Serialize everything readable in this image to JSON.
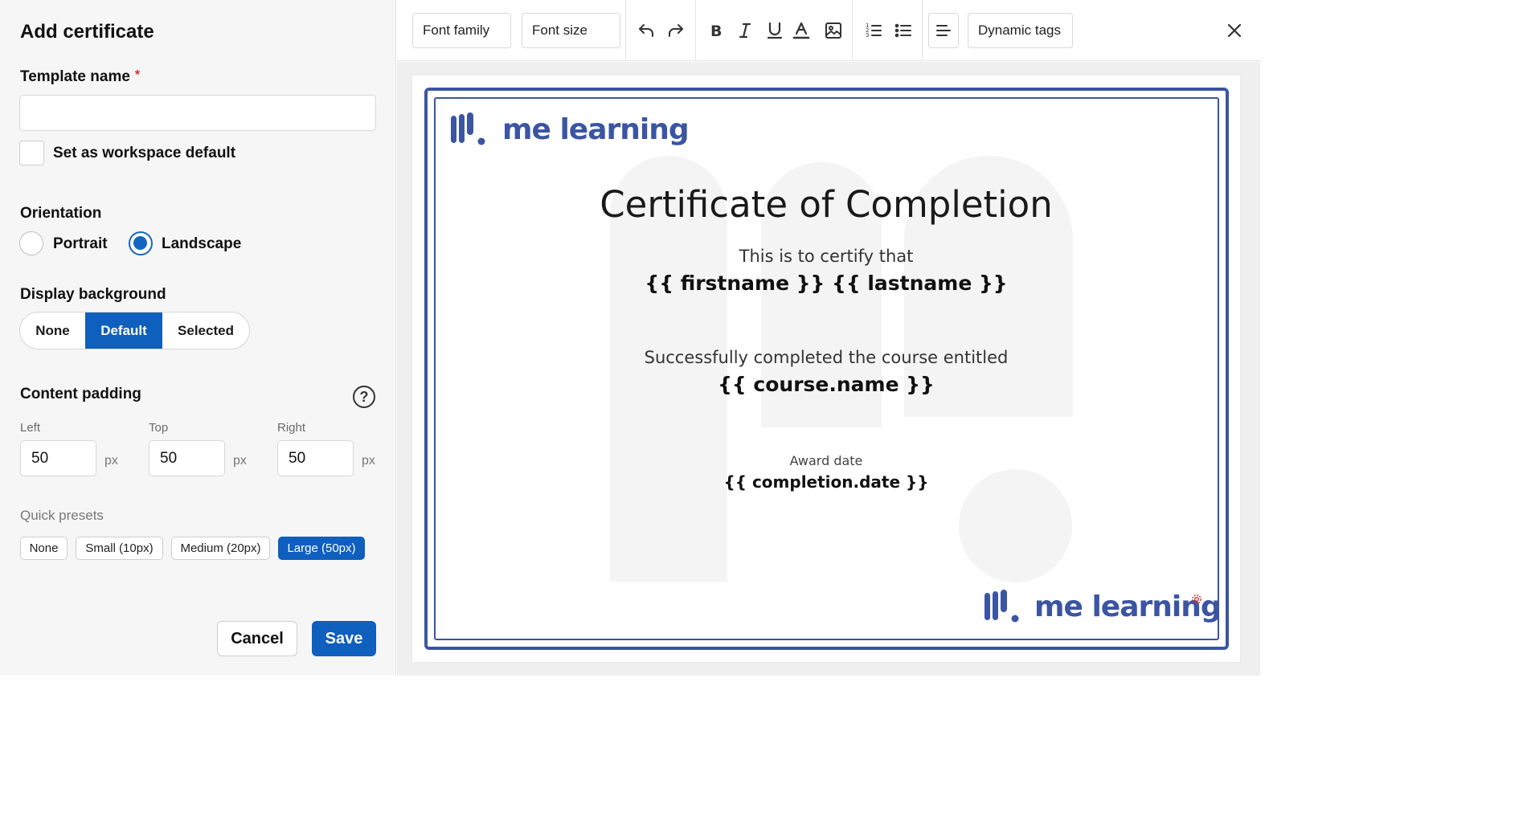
{
  "panel": {
    "title": "Add certificate",
    "template_name_label": "Template name",
    "required_mark": "*",
    "template_name_value": "",
    "workspace_default_label": "Set as workspace default",
    "orientation_label": "Orientation",
    "orientation_options": [
      "Portrait",
      "Landscape"
    ],
    "orientation_selected": "Landscape",
    "display_background_label": "Display background",
    "display_background_options": [
      "None",
      "Default",
      "Selected"
    ],
    "display_background_selected": "Default",
    "content_padding_label": "Content padding",
    "help_glyph": "?",
    "padding": {
      "left_label": "Left",
      "left_value": "50",
      "top_label": "Top",
      "top_value": "50",
      "right_label": "Right",
      "right_value": "50",
      "unit": "px"
    },
    "quick_presets_label": "Quick presets",
    "presets": [
      "None",
      "Small (10px)",
      "Medium (20px)",
      "Large (50px)"
    ],
    "preset_selected": "Large (50px)",
    "cancel_label": "Cancel",
    "save_label": "Save"
  },
  "toolbar": {
    "font_family": "Font family",
    "font_size": "Font size",
    "dynamic_tags": "Dynamic tags",
    "icons": [
      "undo-icon",
      "redo-icon",
      "bold-icon",
      "italic-icon",
      "underline-icon",
      "text-color-icon",
      "image-icon",
      "ordered-list-icon",
      "bullet-list-icon",
      "align-icon",
      "close-icon"
    ]
  },
  "certificate": {
    "logo_text": "me learning",
    "heading": "Certificate of Completion",
    "certify_line": "This is to certify that",
    "name_tags": "{{ firstname }} {{ lastname }}",
    "completed_line": "Successfully completed the course entitled",
    "course_tag": "{{ course.name }}",
    "award_label": "Award date",
    "date_tag": "{{ completion.date }}"
  },
  "colors": {
    "accent": "#0f5fbf",
    "brand": "#3b55a3",
    "required": "#d32f2f"
  }
}
